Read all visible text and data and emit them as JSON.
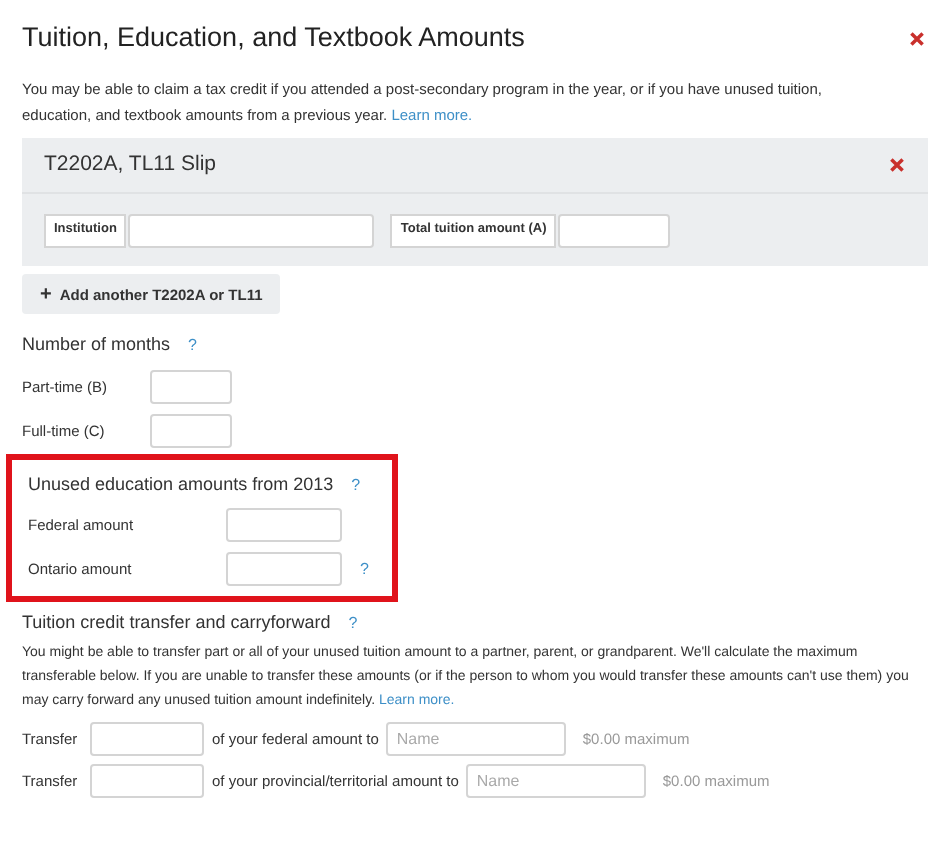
{
  "title": "Tuition, Education, and Textbook Amounts",
  "intro": {
    "text": "You may be able to claim a tax credit if you attended a post-secondary program in the year, or if you have unused tuition, education, and textbook amounts from a previous year.",
    "link": "Learn more."
  },
  "slip": {
    "title": "T2202A, TL11 Slip",
    "fields": [
      {
        "label": "Institution"
      },
      {
        "label": "Total tuition amount (A)"
      }
    ]
  },
  "add_button": {
    "icon": "+",
    "label": "Add another T2202A or TL11"
  },
  "months": {
    "heading": "Number of months",
    "help": "?",
    "rows": [
      {
        "label": "Part-time (B)"
      },
      {
        "label": "Full-time (C)"
      }
    ]
  },
  "unused": {
    "heading": "Unused education amounts from 2013",
    "help": "?",
    "highlighted": true,
    "rows": [
      {
        "label": "Federal amount"
      },
      {
        "label": "Ontario amount",
        "help": "?"
      }
    ]
  },
  "transfer": {
    "heading": "Tuition credit transfer and carryforward",
    "help": "?",
    "text": "You might be able to transfer part or all of your unused tuition amount to a partner, parent, or grandparent. We'll calculate the maximum transferable below. If you are unable to transfer these amounts (or if the person to whom you would transfer these amounts can't use them) you may carry forward any unused tuition amount indefinitely.",
    "link": "Learn more.",
    "rows": [
      {
        "label": "Transfer",
        "middle": "of your federal amount to",
        "placeholder": "Name",
        "maximum": "$0.00 maximum"
      },
      {
        "label": "Transfer",
        "middle": "of your provincial/territorial amount to",
        "placeholder": "Name",
        "maximum": "$0.00 maximum"
      }
    ]
  }
}
